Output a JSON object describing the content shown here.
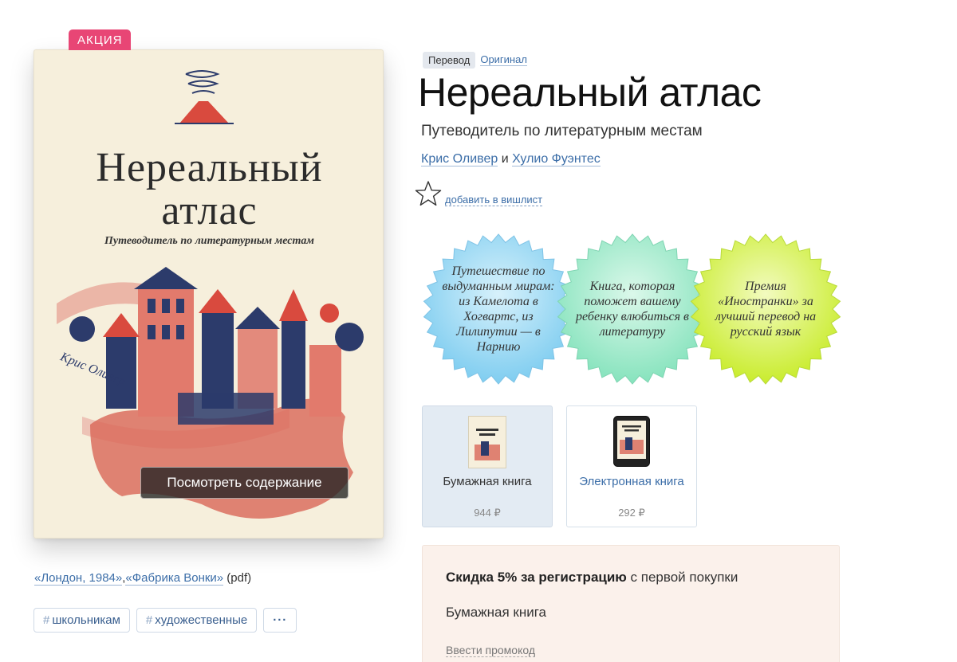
{
  "badge": {
    "sale": "АКЦИЯ"
  },
  "cover": {
    "title_line1": "Нереальный",
    "title_line2": "атлас",
    "subtitle": "Путеводитель по литературным местам",
    "author": "Крис Оливер",
    "preview_button": "Посмотреть содержание"
  },
  "related": {
    "link1": "«Лондон, 1984»",
    "separator": ",",
    "link2": "«Фабрика Вонки»",
    "suffix": " (pdf)"
  },
  "tags": [
    {
      "label": "школьникам"
    },
    {
      "label": "художественные"
    }
  ],
  "tags_more": "···",
  "language": {
    "active": "Перевод",
    "link": "Оригинал"
  },
  "book": {
    "title": "Нереальный атлас",
    "subtitle": "Путеводитель по литературным местам",
    "author1": "Крис Оливер",
    "and": " и ",
    "author2": "Хулио Фуэнтес"
  },
  "wishlist": {
    "label": "добавить в вишлист"
  },
  "stickers": [
    {
      "text": "Путешествие по выдуманным мирам: из Камелота в Хогвартс, из Лилипутии — в Нарнию",
      "color": "#9fd9f2"
    },
    {
      "text": "Книга, которая поможет вашему ребенку влюбиться в литературу",
      "color": "#a8ecd0"
    },
    {
      "text": "Премия «Иностранки» за лучший перевод на русский язык",
      "color": "#dff26a"
    }
  ],
  "formats": [
    {
      "name": "Бумажная книга",
      "price": "944 ₽",
      "selected": true
    },
    {
      "name": "Электронная книга",
      "price": "292 ₽",
      "selected": false
    }
  ],
  "buy": {
    "discount_bold": "Скидка 5% за регистрацию",
    "discount_rest": " с первой покупки",
    "format": "Бумажная книга",
    "promo": "Ввести промокод"
  },
  "colors": {
    "accent": "#e84675",
    "link": "#3c6ea8",
    "cover_bg": "#f6efdc"
  }
}
